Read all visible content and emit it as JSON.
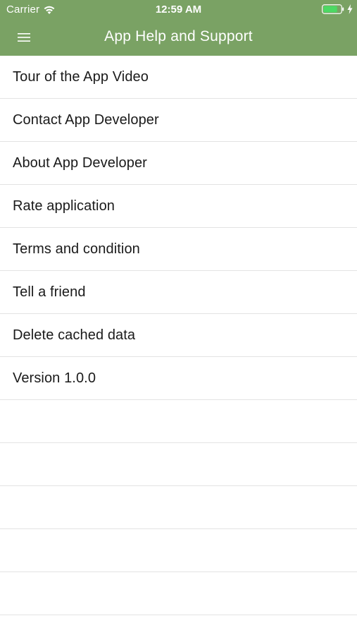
{
  "status_bar": {
    "carrier": "Carrier",
    "time": "12:59 AM",
    "battery_level": 0.8,
    "charging": true
  },
  "nav_bar": {
    "title": "App Help and Support",
    "menu_icon": "hamburger-menu-icon",
    "background_color": "#7aa264"
  },
  "menu_items": [
    {
      "label": "Tour of the App Video"
    },
    {
      "label": "Contact App Developer"
    },
    {
      "label": "About App Developer"
    },
    {
      "label": "Rate application"
    },
    {
      "label": "Terms and condition"
    },
    {
      "label": "Tell a friend"
    },
    {
      "label": "Delete cached data"
    },
    {
      "label": "Version 1.0.0"
    }
  ],
  "empty_row_count": 5,
  "colors": {
    "accent": "#7aa264",
    "battery_fill": "#4cd964",
    "separator": "#e3e3e3"
  }
}
